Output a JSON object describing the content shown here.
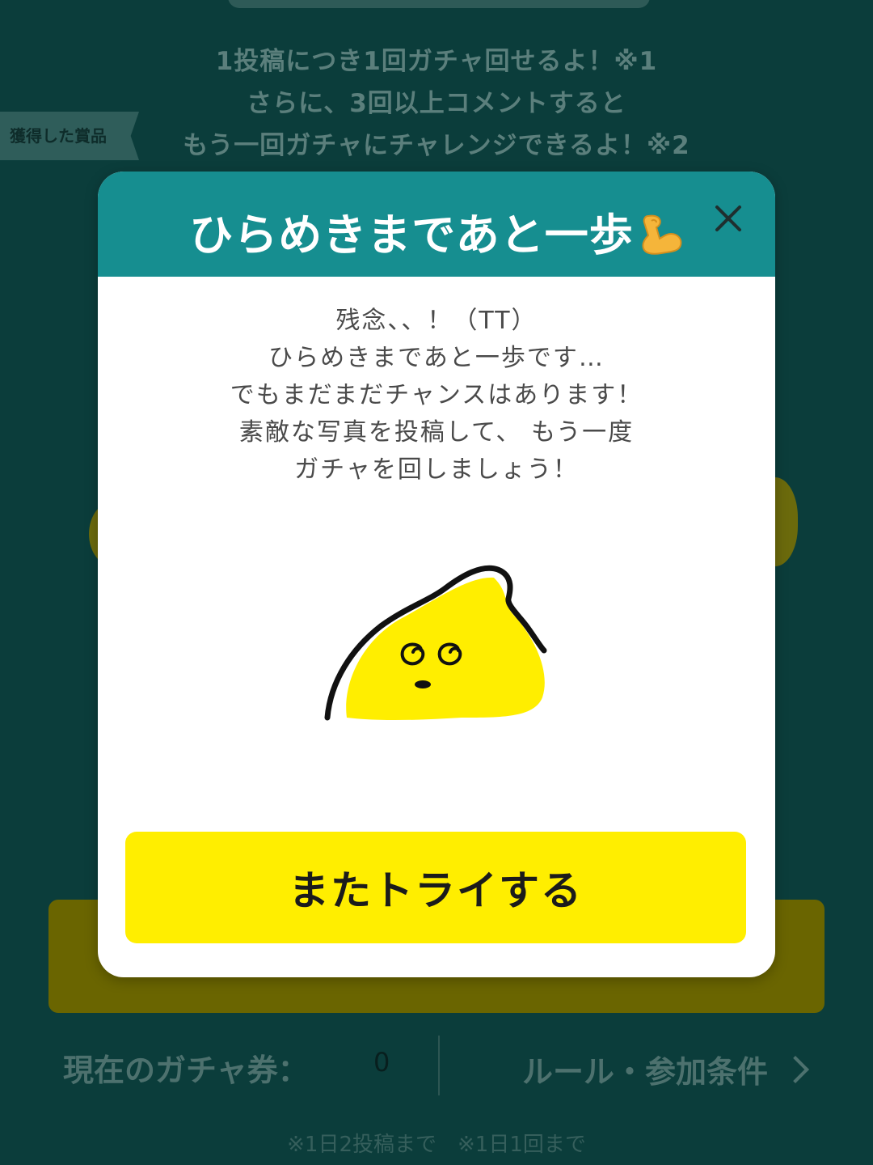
{
  "background": {
    "intro_lines": [
      "1投稿につき1回ガチャ回せるよ！※1",
      "さらに、3回以上コメントすると",
      "もう一回ガチャにチャレンジできるよ！※2"
    ],
    "prize_tab_label": "獲得した賞品",
    "ticket_label": "現在のガチャ券：",
    "ticket_count": "0",
    "rules_link_label": "ルール・参加条件",
    "footnote": "※1日2投稿まで　※1日1回まで"
  },
  "modal": {
    "title": "ひらめきまであと一歩",
    "title_emoji": "flexed-biceps-icon",
    "close_icon": "close-icon",
    "message_lines": [
      "残念、、！（TT）",
      "ひらめきまであと一歩です…",
      "でもまだまだチャンスはあります！",
      "素敵な写真を投稿して、 もう一度",
      "ガチャを回しましょう！"
    ],
    "character_icon": "dizzy-yellow-blob-character-icon",
    "retry_button_label": "またトライする"
  },
  "colors": {
    "overlay_background": "#0b3d3b",
    "modal_header": "#168e90",
    "primary_button": "#ffee00",
    "character_yellow": "#ffee00"
  }
}
